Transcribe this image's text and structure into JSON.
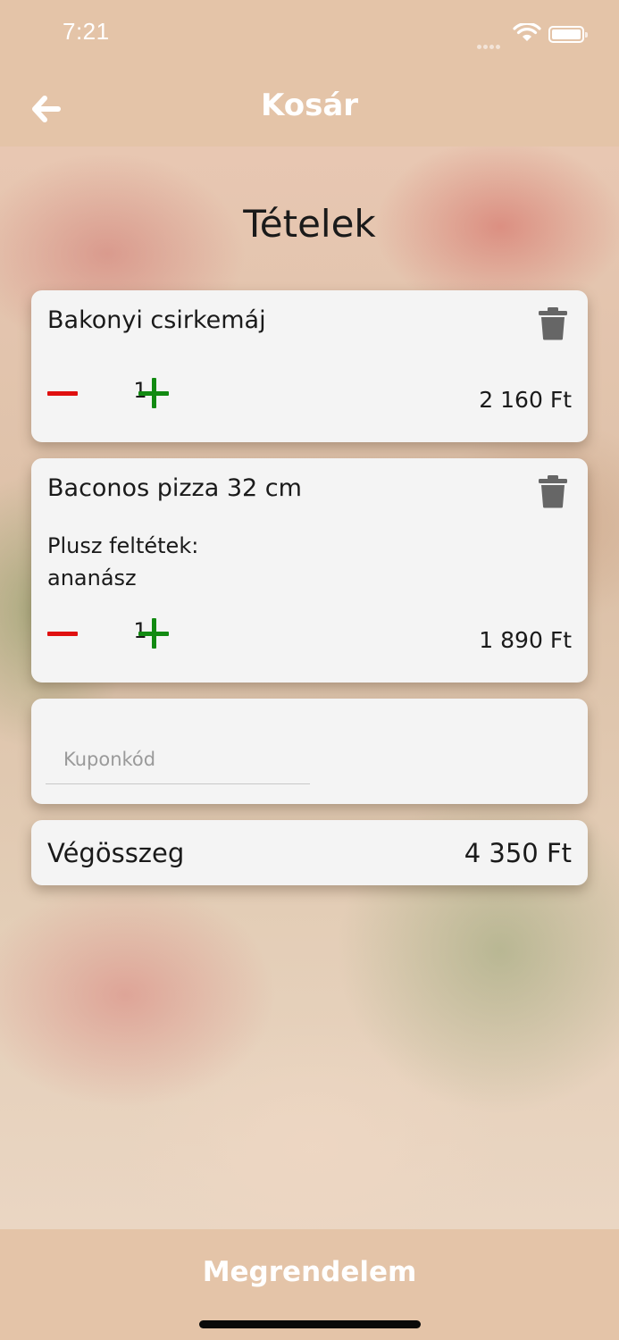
{
  "status_bar": {
    "time": "7:21"
  },
  "nav": {
    "title": "Kosár",
    "back_icon": "arrow-left-icon"
  },
  "cart": {
    "section_title": "Tételek",
    "items": [
      {
        "name": "Bakonyi csirkemáj",
        "quantity": "1",
        "price": "2 160 Ft"
      },
      {
        "name": "Baconos pizza 32 cm",
        "extras_label": "Plusz feltétek:",
        "extras": "ananász",
        "quantity": "1",
        "price": "1 890 Ft"
      }
    ],
    "coupon": {
      "placeholder": "Kuponkód",
      "value": ""
    },
    "total": {
      "label": "Végösszeg",
      "value": "4 350 Ft"
    }
  },
  "order_button": {
    "label": "Megrendelem"
  },
  "colors": {
    "header_bg": "#e4c4a8",
    "minus": "#e01010",
    "plus": "#128a12",
    "card_bg": "#f4f4f4"
  }
}
